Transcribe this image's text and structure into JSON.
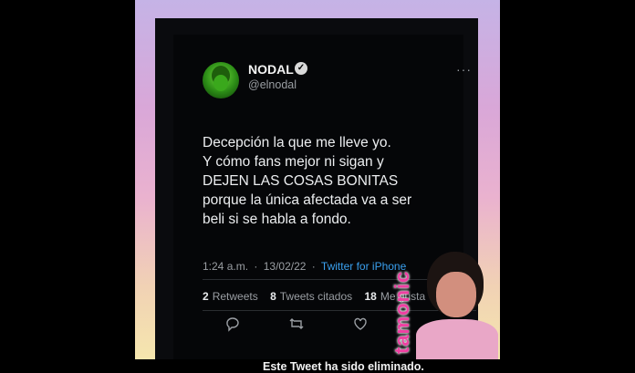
{
  "tweet": {
    "name": "NODAL",
    "handle": "@elnodal",
    "more_label": "···",
    "verified_glyph": "✓",
    "text": "Decepción la que me lleve yo.\n Y cómo fans mejor ni sigan y DEJEN LAS COSAS BONITAS porque la única afectada va a ser beli si se habla a fondo.",
    "time": "1:24 a.m.",
    "separator": "·",
    "date": "13/02/22",
    "source": "Twitter for iPhone",
    "stats": {
      "retweets_count": "2",
      "retweets_label": "Retweets",
      "quotes_count": "8",
      "quotes_label": "Tweets citados",
      "likes_count": "18",
      "likes_label": "Me gusta"
    },
    "actions": [
      "reply-icon",
      "retweet-icon",
      "like-icon"
    ],
    "deleted_notice": "Este Tweet ha sido eliminado."
  },
  "sticker": {
    "word": "tamonic"
  },
  "colors": {
    "link": "#3aa0ef",
    "accent_pink": "#ef3fa2"
  }
}
